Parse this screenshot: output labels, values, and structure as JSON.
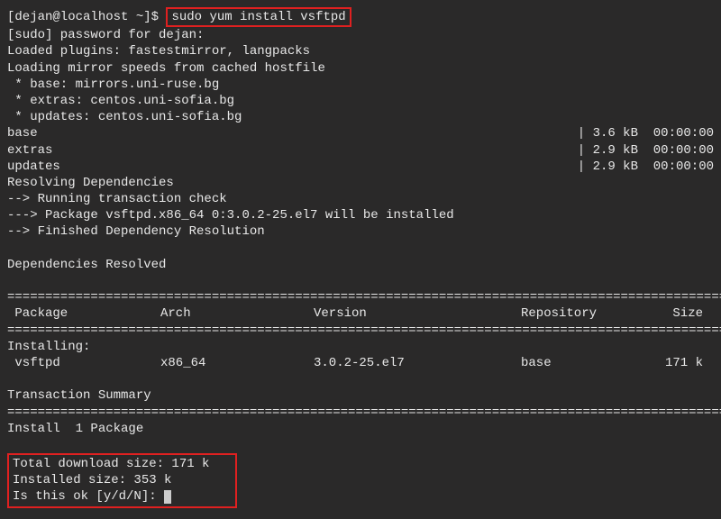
{
  "prompt": {
    "user_host": "[dejan@localhost ~]$ ",
    "command": "sudo yum install vsftpd"
  },
  "output": {
    "sudo_line": "[sudo] password for dejan:",
    "plugins": "Loaded plugins: fastestmirror, langpacks",
    "loading": "Loading mirror speeds from cached hostfile",
    "mirror_base": " * base: mirrors.uni-ruse.bg",
    "mirror_extras": " * extras: centos.uni-sofia.bg",
    "mirror_updates": " * updates: centos.uni-sofia.bg",
    "repo_base": {
      "name": "base",
      "info": "| 3.6 kB  00:00:00"
    },
    "repo_extras": {
      "name": "extras",
      "info": "| 2.9 kB  00:00:00"
    },
    "repo_updates": {
      "name": "updates",
      "info": "| 2.9 kB  00:00:00"
    },
    "resolving": "Resolving Dependencies",
    "trans_check": "--> Running transaction check",
    "pkg_install": "---> Package vsftpd.x86_64 0:3.0.2-25.el7 will be installed",
    "finished_dep": "--> Finished Dependency Resolution",
    "deps_resolved": "Dependencies Resolved",
    "divider": "================================================================================================",
    "header": {
      "package": " Package",
      "arch": "Arch",
      "version": "Version",
      "repo": "Repository",
      "size": " Size"
    },
    "installing_label": "Installing:",
    "pkg_row": {
      "package": " vsftpd",
      "arch": "x86_64",
      "version": "3.0.2-25.el7",
      "repo": "base",
      "size": "171 k"
    },
    "trans_summary": "Transaction Summary",
    "install_count": "Install  1 Package",
    "total_download": "Total download size: 171 k",
    "installed_size": "Installed size: 353 k",
    "confirm": "Is this ok [y/d/N]: "
  }
}
